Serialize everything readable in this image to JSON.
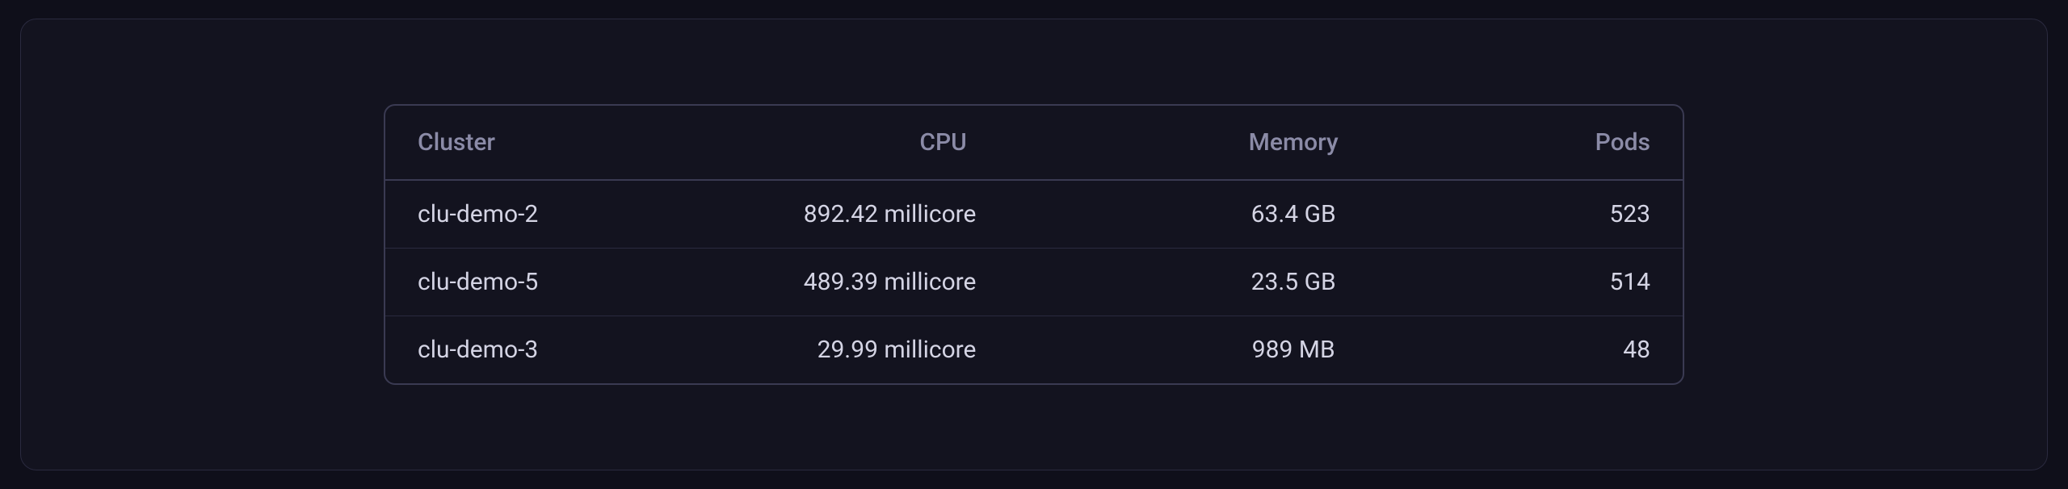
{
  "table": {
    "headers": {
      "cluster": "Cluster",
      "cpu": "CPU",
      "memory": "Memory",
      "pods": "Pods"
    },
    "rows": [
      {
        "cluster": "clu-demo-2",
        "cpu": "892.42 millicore",
        "memory": "63.4 GB",
        "pods": "523"
      },
      {
        "cluster": "clu-demo-5",
        "cpu": "489.39 millicore",
        "memory": "23.5 GB",
        "pods": "514"
      },
      {
        "cluster": "clu-demo-3",
        "cpu": "29.99 millicore",
        "memory": "989 MB",
        "pods": "48"
      }
    ]
  }
}
